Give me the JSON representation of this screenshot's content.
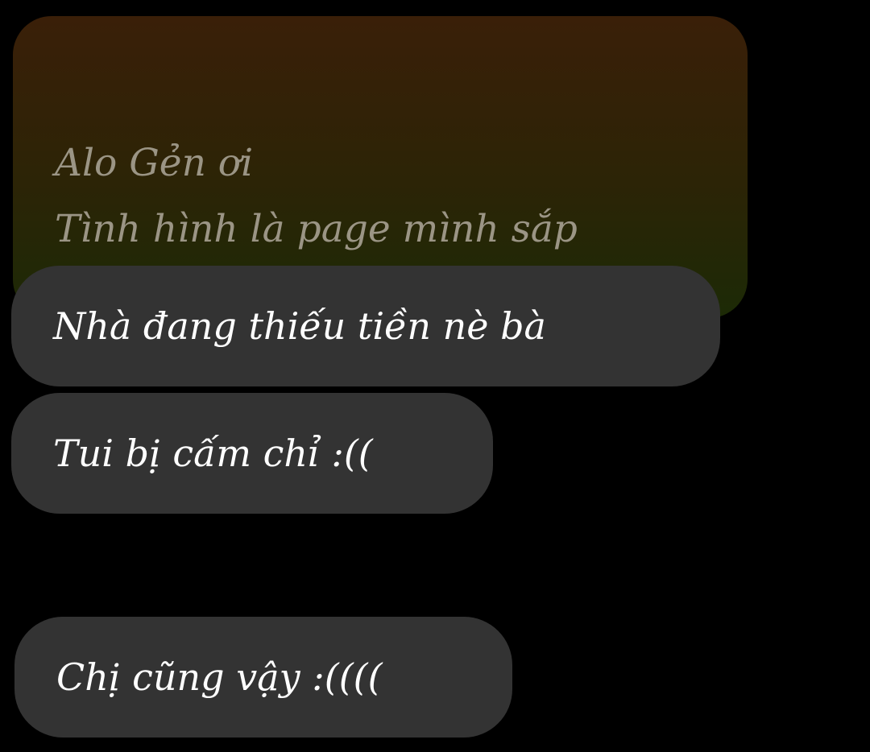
{
  "messages": {
    "quoted": {
      "text": "Alo Gẻn ơi\nTình hình là page mình sắp\nhợp tác làm offline á..."
    },
    "list": [
      {
        "text": "Nhà đang thiếu tiền nè bà"
      },
      {
        "text": "Tui bị cấm chỉ :(("
      },
      {
        "text": "Chị cũng vậy :(((("
      }
    ]
  },
  "colors": {
    "background": "#000000",
    "bubble": "#333333",
    "quoted_gradient_top": "#3a1f08",
    "quoted_gradient_bottom": "#1c2a06",
    "text": "#ffffff",
    "quoted_text": "#9b9585"
  }
}
